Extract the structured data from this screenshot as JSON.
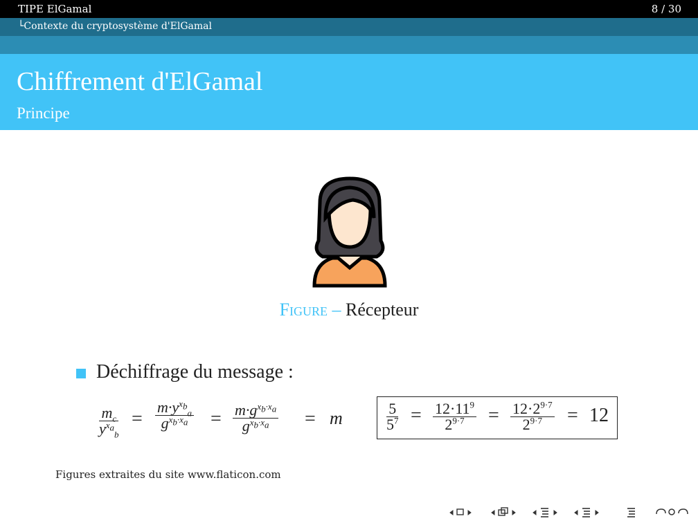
{
  "header": {
    "title": "TIPE ElGamal",
    "page": "8 / 30",
    "section": "└Contexte du cryptosystème d'ElGamal"
  },
  "slide": {
    "title": "Chiffrement d'ElGamal",
    "subtitle": "Principe"
  },
  "figure": {
    "icon": "woman-avatar-icon",
    "caption_label": "Figure –",
    "caption_text": " Récepteur"
  },
  "bullet": {
    "text": "Déchiffrage du message :"
  },
  "formula": {
    "f1_num": "m",
    "f1_num_sub": "c",
    "f1_den": "y",
    "f1_den_sub": "b",
    "f1_den_sup": "x",
    "f1_den_supsub": "a",
    "f2_num": "m·y",
    "f2_num_sub": "a",
    "f2_num_sup": "x",
    "f2_num_supsub": "b",
    "f2_den": "g",
    "f2_den_sup": "x",
    "f2_den_supsub1": "b",
    "f2_den_sup2": "·x",
    "f2_den_supsub2": "a",
    "f3_num": "m·g",
    "f3_num_sup": "x",
    "f3_num_supsub1": "b",
    "f3_num_sup2": "·x",
    "f3_num_supsub2": "a",
    "f3_den": "g",
    "f3_den_sup": "x",
    "f3_den_supsub1": "b",
    "f3_den_sup2": "·x",
    "f3_den_supsub2": "a",
    "eq": "=",
    "result": "m"
  },
  "example": {
    "a_num": "5",
    "a_den": "5",
    "a_den_sup": "7",
    "b_num": "12·11",
    "b_num_sup": "9",
    "b_den": "2",
    "b_den_sup": "9·7",
    "c_num": "12·2",
    "c_num_sup": "9·7",
    "c_den": "2",
    "c_den_sup": "9·7",
    "eq": "=",
    "result": "12"
  },
  "footnote": "Figures extraites du site www.flaticon.com",
  "navigation": {
    "icons": [
      "nav-prev-frame-icon",
      "nav-frame-icon",
      "nav-next-frame-icon",
      "nav-prev-subsection-icon",
      "nav-subsection-icon",
      "nav-next-subsection-icon",
      "nav-prev-section-icon",
      "nav-section-icon",
      "nav-next-section-icon",
      "nav-doc-icon",
      "nav-search-icon",
      "nav-back-icon"
    ]
  }
}
